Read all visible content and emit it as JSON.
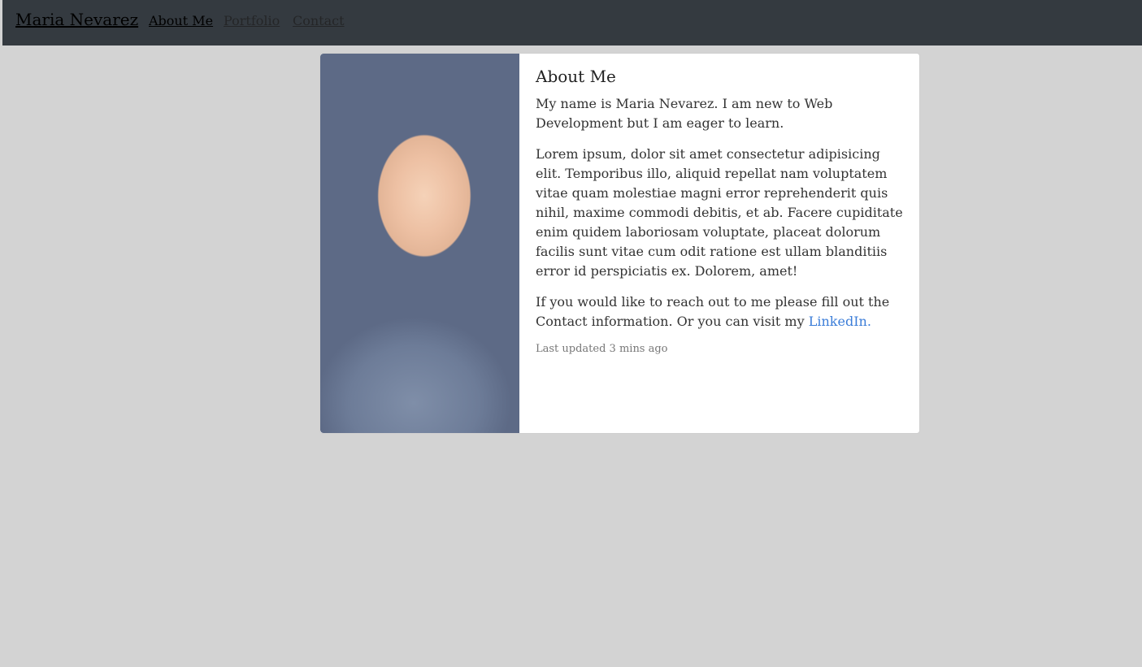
{
  "nav": {
    "brand": "Maria Nevarez",
    "links": [
      "About Me",
      "Portfolio",
      "Contact"
    ]
  },
  "card": {
    "title": "About Me",
    "paragraph1": "My name is Maria Nevarez. I am new to Web Development but I am eager to learn.",
    "paragraph2": "Lorem ipsum, dolor sit amet consectetur adipisicing elit. Temporibus illo, aliquid repellat nam voluptatem vitae quam molestiae magni error reprehenderit quis nihil, maxime commodi debitis, et ab. Facere cupiditate enim quidem laboriosam voluptate, placeat dolorum facilis sunt vitae cum odit ratione est ullam blanditiis error id perspiciatis ex. Dolorem, amet!",
    "paragraph3_text": "If you would like to reach out to me please fill out the Contact information. Or you can visit my",
    "linkedin_label": "LinkedIn.",
    "updated": "Last updated 3 mins ago"
  },
  "colors": {
    "navbar": "#343a40",
    "page_bg": "#d3d3d3",
    "link": "#3b7dd8"
  }
}
